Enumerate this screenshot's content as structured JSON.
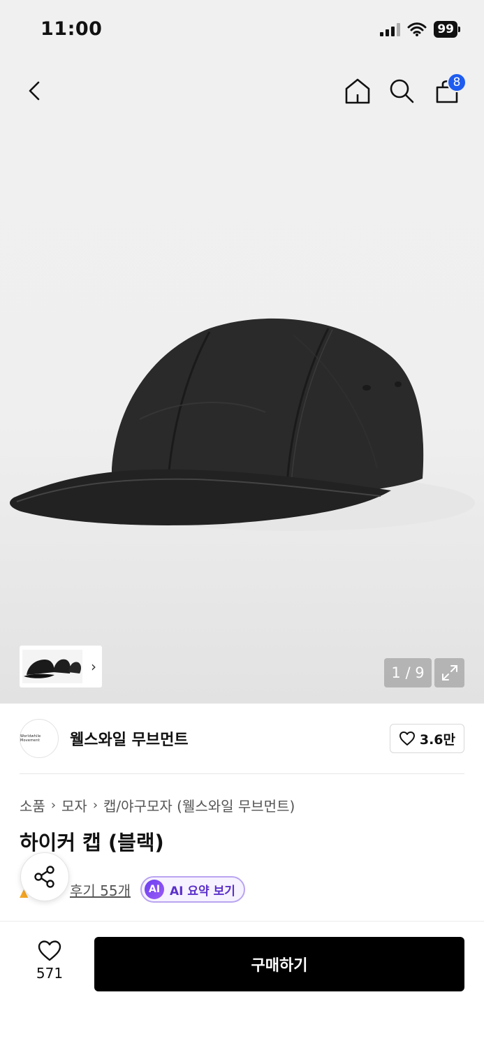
{
  "status_bar": {
    "time": "11:00",
    "battery": "99"
  },
  "header": {
    "cart_count": "8"
  },
  "gallery": {
    "page_counter": "1 / 9",
    "thumb_arrow": "›"
  },
  "brand": {
    "name": "웰스와일 무브먼트",
    "likes": "3.6만",
    "logo_text": "Worldwhile Movement"
  },
  "breadcrumb": {
    "items": [
      "소품",
      "모자",
      "캡/야구모자 (웰스와일 무브먼트)"
    ]
  },
  "product": {
    "title": "하이커 캡 (블랙)"
  },
  "reviews": {
    "count_label": "후기 55개",
    "ai_badge": "AI",
    "ai_summary_label": "AI 요약 보기"
  },
  "bottom": {
    "wish_count": "571",
    "buy_label": "구매하기"
  },
  "colors": {
    "accent_blue": "#1e5cf0",
    "buy_button": "#000000",
    "ai_purple": "#6a3df0"
  }
}
